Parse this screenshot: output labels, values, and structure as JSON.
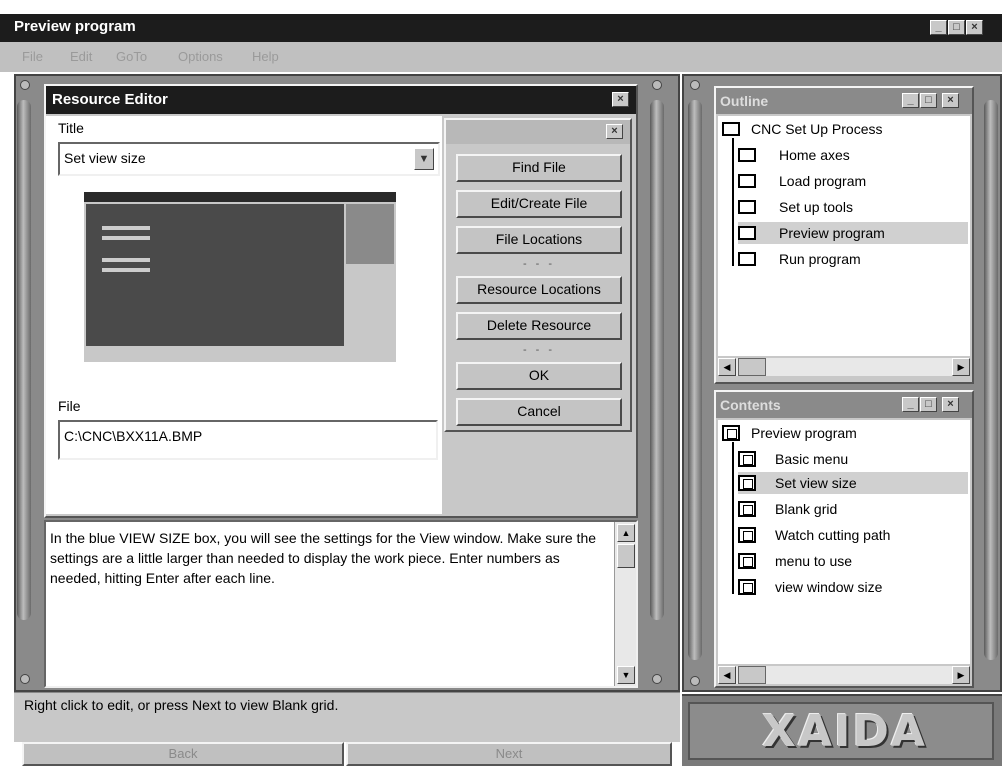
{
  "window": {
    "title": "Preview program",
    "controls": {
      "minimize": "_",
      "maximize": "□",
      "close": "×"
    }
  },
  "menu": [
    "File",
    "Edit",
    "GoTo",
    "Options",
    "Help"
  ],
  "resource_editor": {
    "title": "Resource Editor",
    "title_label": "Title",
    "title_value": "Set view size",
    "file_label": "File",
    "file_value": "C:\\CNC\\BXX11A.BMP",
    "buttons": {
      "find_file": "Find File",
      "edit_create_file": "Edit/Create File",
      "file_locations": "File Locations",
      "resource_locations": "Resource Locations",
      "delete_resource": "Delete Resource",
      "ok": "OK",
      "cancel": "Cancel",
      "separator": "- - -"
    }
  },
  "description": "In the blue VIEW SIZE box, you will see the settings for the View window. Make sure the settings are a little larger than needed to display the work piece.  Enter numbers as needed, hitting Enter after each line.",
  "status": "Right click to edit, or press Next to view Blank grid.",
  "nav": {
    "back": "Back",
    "next": "Next"
  },
  "outline": {
    "title": "Outline",
    "root": "CNC Set Up Process",
    "items": [
      "Home axes",
      "Load program",
      "Set up tools",
      "Preview program",
      "Run program"
    ],
    "selected": "Preview program"
  },
  "contents": {
    "title": "Contents",
    "root": "Preview program",
    "items": [
      "Basic menu",
      "Set view size",
      "Blank grid",
      "Watch cutting path",
      "menu to use",
      "view window size"
    ],
    "selected": "Set view size"
  },
  "logo": "XAIDA",
  "colors": {
    "title_bar": "#1a1a1a",
    "frame": "#8a8a8a",
    "panel": "#c8c8c8",
    "selection": "#d0d0d0"
  }
}
